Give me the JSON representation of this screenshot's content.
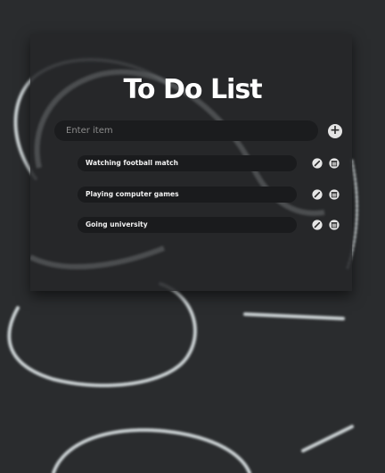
{
  "app": {
    "title": "To Do List"
  },
  "input": {
    "placeholder": "Enter item",
    "value": ""
  },
  "add_button": {
    "icon": "plus-icon"
  },
  "todos": [
    {
      "text": "Watching football match",
      "edit_icon": "pencil-icon",
      "delete_icon": "trash-icon"
    },
    {
      "text": "Playing computer games",
      "edit_icon": "pencil-icon",
      "delete_icon": "trash-icon"
    },
    {
      "text": "Going university",
      "edit_icon": "pencil-icon",
      "delete_icon": "trash-icon"
    }
  ],
  "colors": {
    "background": "#2b2d2f",
    "card": "#262729",
    "pill": "#1a1b1d",
    "text": "#ffffff",
    "chalk": "#dfe6e8"
  }
}
